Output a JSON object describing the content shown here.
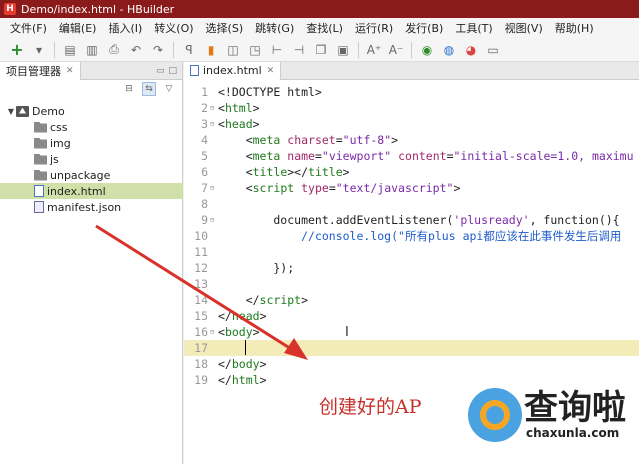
{
  "window": {
    "title": "Demo/index.html - HBuilder",
    "app_icon_letter": "H"
  },
  "menubar": {
    "items": [
      "文件(F)",
      "编辑(E)",
      "插入(I)",
      "转义(O)",
      "选择(S)",
      "跳转(G)",
      "查找(L)",
      "运行(R)",
      "发行(B)",
      "工具(T)",
      "视图(V)",
      "帮助(H)"
    ]
  },
  "toolbar": {
    "icons": [
      "new-icon",
      "dropdown-icon",
      "save-icon",
      "save-all-icon",
      "print-icon",
      "undo-icon",
      "redo-icon",
      "format-icon",
      "bookmark-icon",
      "open-file-icon",
      "open-folder-icon",
      "indent-icon",
      "outdent-icon",
      "copy-icon",
      "paste-icon",
      "font-larger-icon",
      "font-smaller-icon",
      "run-icon",
      "browser-icon",
      "chrome-icon",
      "comment-icon"
    ]
  },
  "project_panel": {
    "tab_label": "项目管理器",
    "tree": [
      {
        "label": "Demo",
        "type": "project",
        "expanded": true,
        "depth": 0
      },
      {
        "label": "css",
        "type": "folder",
        "depth": 1
      },
      {
        "label": "img",
        "type": "folder",
        "depth": 1
      },
      {
        "label": "js",
        "type": "folder",
        "depth": 1
      },
      {
        "label": "unpackage",
        "type": "folder",
        "depth": 1
      },
      {
        "label": "index.html",
        "type": "file-html",
        "depth": 1,
        "selected": true
      },
      {
        "label": "manifest.json",
        "type": "file-json",
        "depth": 1
      }
    ]
  },
  "editor": {
    "tab_label": "index.html",
    "current_line": 17,
    "lines": [
      {
        "n": "1",
        "fold": "",
        "parts": [
          {
            "c": "plain",
            "t": "<!DOCTYPE html>"
          }
        ]
      },
      {
        "n": "2",
        "fold": "⊟",
        "parts": [
          {
            "c": "plain",
            "t": "<"
          },
          {
            "c": "tag",
            "t": "html"
          },
          {
            "c": "plain",
            "t": ">"
          }
        ]
      },
      {
        "n": "3",
        "fold": "⊟",
        "parts": [
          {
            "c": "plain",
            "t": "<"
          },
          {
            "c": "tag",
            "t": "head"
          },
          {
            "c": "plain",
            "t": ">"
          }
        ]
      },
      {
        "n": "4",
        "fold": "",
        "parts": [
          {
            "c": "plain",
            "t": "    <"
          },
          {
            "c": "tag",
            "t": "meta"
          },
          {
            "c": "plain",
            "t": " "
          },
          {
            "c": "attr",
            "t": "charset"
          },
          {
            "c": "plain",
            "t": "="
          },
          {
            "c": "str",
            "t": "\"utf-8\""
          },
          {
            "c": "plain",
            "t": ">"
          }
        ]
      },
      {
        "n": "5",
        "fold": "",
        "parts": [
          {
            "c": "plain",
            "t": "    <"
          },
          {
            "c": "tag",
            "t": "meta"
          },
          {
            "c": "plain",
            "t": " "
          },
          {
            "c": "attr",
            "t": "name"
          },
          {
            "c": "plain",
            "t": "="
          },
          {
            "c": "str",
            "t": "\"viewport\""
          },
          {
            "c": "plain",
            "t": " "
          },
          {
            "c": "attr",
            "t": "content"
          },
          {
            "c": "plain",
            "t": "="
          },
          {
            "c": "str",
            "t": "\"initial-scale=1.0, maximu"
          }
        ]
      },
      {
        "n": "6",
        "fold": "",
        "parts": [
          {
            "c": "plain",
            "t": "    <"
          },
          {
            "c": "tag",
            "t": "title"
          },
          {
            "c": "plain",
            "t": "></"
          },
          {
            "c": "tag",
            "t": "title"
          },
          {
            "c": "plain",
            "t": ">"
          }
        ]
      },
      {
        "n": "7",
        "fold": "⊟",
        "parts": [
          {
            "c": "plain",
            "t": "    <"
          },
          {
            "c": "tag",
            "t": "script"
          },
          {
            "c": "plain",
            "t": " "
          },
          {
            "c": "attr",
            "t": "type"
          },
          {
            "c": "plain",
            "t": "="
          },
          {
            "c": "str",
            "t": "\"text/javascript\""
          },
          {
            "c": "plain",
            "t": ">"
          }
        ]
      },
      {
        "n": "8",
        "fold": "",
        "parts": [
          {
            "c": "plain",
            "t": ""
          }
        ]
      },
      {
        "n": "9",
        "fold": "⊟",
        "parts": [
          {
            "c": "plain",
            "t": "        document.addEventListener("
          },
          {
            "c": "str",
            "t": "'plusready'"
          },
          {
            "c": "plain",
            "t": ", function(){"
          }
        ]
      },
      {
        "n": "10",
        "fold": "",
        "parts": [
          {
            "c": "plain",
            "t": "            "
          },
          {
            "c": "cm",
            "t": "//console.log(\"所有plus api都应该在此事件发生后调用"
          }
        ]
      },
      {
        "n": "11",
        "fold": "",
        "parts": [
          {
            "c": "plain",
            "t": ""
          }
        ]
      },
      {
        "n": "12",
        "fold": "",
        "parts": [
          {
            "c": "plain",
            "t": "        });"
          }
        ]
      },
      {
        "n": "13",
        "fold": "",
        "parts": [
          {
            "c": "plain",
            "t": ""
          }
        ]
      },
      {
        "n": "14",
        "fold": "",
        "parts": [
          {
            "c": "plain",
            "t": "    </"
          },
          {
            "c": "tag",
            "t": "script"
          },
          {
            "c": "plain",
            "t": ">"
          }
        ]
      },
      {
        "n": "15",
        "fold": "",
        "parts": [
          {
            "c": "plain",
            "t": "</"
          },
          {
            "c": "tag",
            "t": "head"
          },
          {
            "c": "plain",
            "t": ">"
          }
        ]
      },
      {
        "n": "16",
        "fold": "⊟",
        "parts": [
          {
            "c": "plain",
            "t": "<"
          },
          {
            "c": "tag",
            "t": "body"
          },
          {
            "c": "plain",
            "t": ">"
          }
        ]
      },
      {
        "n": "17",
        "fold": "",
        "parts": [
          {
            "c": "plain",
            "t": ""
          }
        ]
      },
      {
        "n": "18",
        "fold": "",
        "parts": [
          {
            "c": "plain",
            "t": "</"
          },
          {
            "c": "tag",
            "t": "body"
          },
          {
            "c": "plain",
            "t": ">"
          }
        ]
      },
      {
        "n": "19",
        "fold": "",
        "parts": [
          {
            "c": "plain",
            "t": "</"
          },
          {
            "c": "tag",
            "t": "html"
          },
          {
            "c": "plain",
            "t": ">"
          }
        ]
      }
    ]
  },
  "annotation": {
    "caption": "创建好的AP",
    "arrow_color": "#d9322a"
  },
  "watermark": {
    "text": "查询啦",
    "url": "chaxunla.com"
  }
}
